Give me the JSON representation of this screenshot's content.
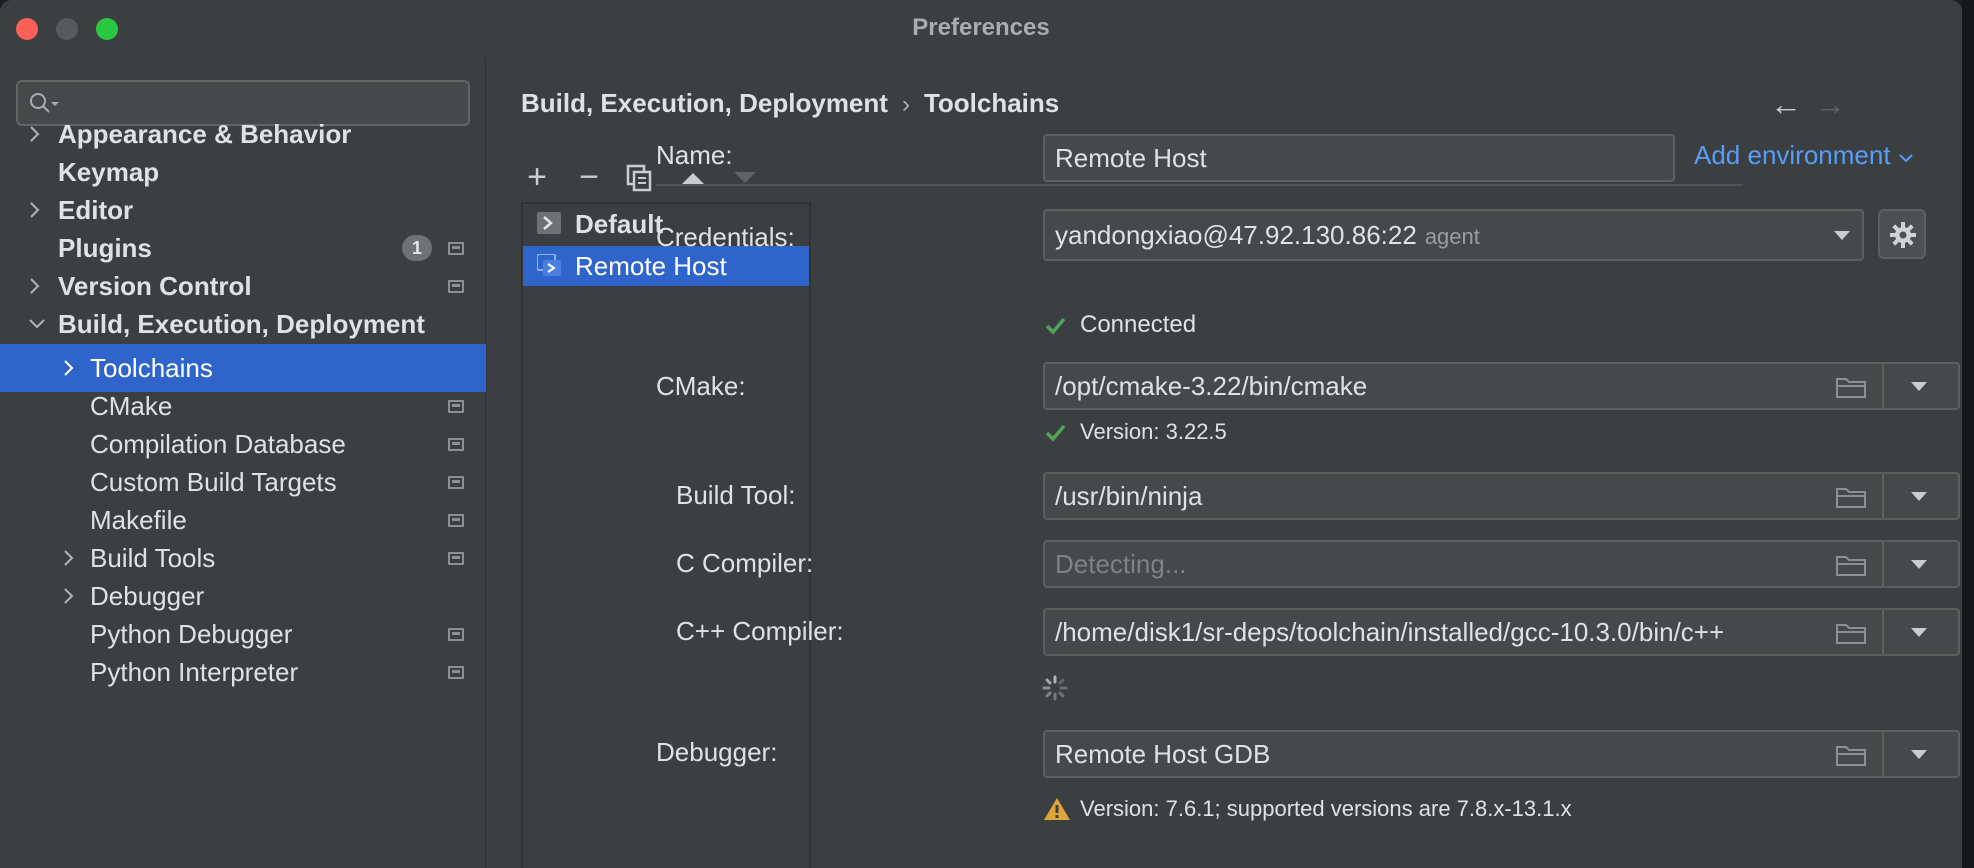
{
  "window": {
    "title": "Preferences"
  },
  "search": {
    "placeholder": ""
  },
  "sidebar": {
    "items": [
      {
        "label": "Appearance & Behavior",
        "chevron": "right"
      },
      {
        "label": "Keymap"
      },
      {
        "label": "Editor",
        "chevron": "right"
      },
      {
        "label": "Plugins",
        "badge": "1"
      },
      {
        "label": "Version Control",
        "chevron": "right"
      },
      {
        "label": "Build, Execution, Deployment",
        "chevron": "down"
      },
      {
        "label": "Toolchains",
        "chevron": "right",
        "selected": true
      },
      {
        "label": "CMake"
      },
      {
        "label": "Compilation Database"
      },
      {
        "label": "Custom Build Targets"
      },
      {
        "label": "Makefile"
      },
      {
        "label": "Build Tools",
        "chevron": "right"
      },
      {
        "label": "Debugger",
        "chevron": "right"
      },
      {
        "label": "Python Debugger"
      },
      {
        "label": "Python Interpreter"
      }
    ]
  },
  "breadcrumb": {
    "parent": "Build, Execution, Deployment",
    "current": "Toolchains",
    "separator": "›"
  },
  "nav": {
    "back": "←",
    "forward": "→"
  },
  "toolbar": {
    "add": "+",
    "remove": "−",
    "copy": "copy-icon",
    "up": "up-icon",
    "down": "down-icon"
  },
  "toolchains": {
    "items": [
      {
        "label": "Default",
        "selected": false
      },
      {
        "label": "Remote Host",
        "selected": true
      }
    ]
  },
  "form": {
    "name": {
      "label": "Name:",
      "value": "Remote Host"
    },
    "add_environment": "Add environment",
    "credentials": {
      "label": "Credentials:",
      "value": "yandongxiao@47.92.130.86:22",
      "suffix": "agent",
      "status": "Connected"
    },
    "cmake": {
      "label": "CMake:",
      "value": "/opt/cmake-3.22/bin/cmake",
      "status": "Version: 3.22.5"
    },
    "build_tool": {
      "label": "Build Tool:",
      "value": "/usr/bin/ninja"
    },
    "c_compiler": {
      "label": "C Compiler:",
      "placeholder": "Detecting..."
    },
    "cpp_compiler": {
      "label": "C++ Compiler:",
      "value": "/home/disk1/sr-deps/toolchain/installed/gcc-10.3.0/bin/c++"
    },
    "debugger": {
      "label": "Debugger:",
      "value": "Remote Host GDB",
      "warning": "Version: 7.6.1; supported versions are 7.8.x-13.1.x"
    }
  },
  "colors": {
    "accent": "#2f65ca",
    "link": "#589df6",
    "success": "#4fa35a",
    "warning": "#e0a53a"
  }
}
